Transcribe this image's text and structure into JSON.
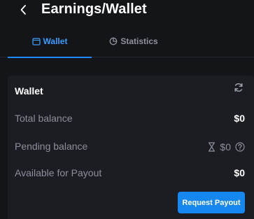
{
  "header": {
    "back_icon": "chevron-left-icon",
    "title": "Earnings/Wallet"
  },
  "tabs": [
    {
      "label": "Wallet",
      "icon": "wallet-icon",
      "active": true
    },
    {
      "label": "Statistics",
      "icon": "pie-chart-icon",
      "active": false
    }
  ],
  "wallet_card": {
    "title": "Wallet",
    "refresh_icon": "refresh-icon",
    "rows": [
      {
        "label": "Total balance",
        "value": "$0"
      },
      {
        "label": "Pending balance",
        "value": "$0",
        "icons": [
          "hourglass-icon",
          "help-circle-icon"
        ]
      },
      {
        "label": "Available for Payout",
        "value": "$0"
      }
    ],
    "request_button": "Request Payout"
  },
  "colors": {
    "background": "#141519",
    "card": "#1c1d22",
    "accent": "#1e88ff",
    "muted_text": "#8a909c"
  }
}
